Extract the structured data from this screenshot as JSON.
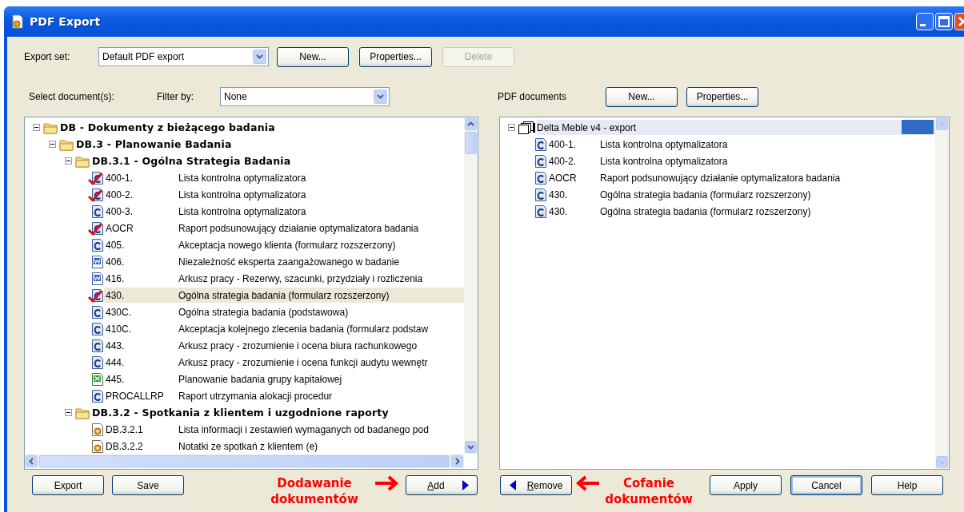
{
  "window": {
    "title": "PDF Export"
  },
  "export_set": {
    "label": "Export set:",
    "value": "Default PDF export",
    "buttons": [
      {
        "label": "New...",
        "disabled": false
      },
      {
        "label": "Properties...",
        "disabled": false
      },
      {
        "label": "Delete",
        "disabled": true
      }
    ]
  },
  "select_label": "Select document(s):",
  "filter": {
    "label": "Filter by:",
    "value": "None"
  },
  "pdf_header": {
    "label": "PDF documents",
    "buttons": [
      {
        "label": "New...",
        "disabled": false
      },
      {
        "label": "Properties...",
        "disabled": false
      }
    ]
  },
  "left_tree": {
    "items": [
      {
        "kind": "folder",
        "label": "DB - Dokumenty z bieżącego badania",
        "expanded": true,
        "children": [
          {
            "kind": "folder",
            "label": "DB.3 - Planowanie Badania",
            "expanded": true,
            "children": [
              {
                "kind": "folder",
                "label": "DB.3.1 - Ogólna Strategia Badania",
                "expanded": true,
                "children": [
                  {
                    "kind": "c-doc",
                    "code": "400-1.",
                    "title": "Lista kontrolna optymalizatora",
                    "checked": true,
                    "selected": false
                  },
                  {
                    "kind": "c-doc",
                    "code": "400-2.",
                    "title": "Lista kontrolna optymalizatora",
                    "checked": true,
                    "selected": false
                  },
                  {
                    "kind": "c-doc",
                    "code": "400-3.",
                    "title": "Lista kontrolna optymalizatora",
                    "checked": false,
                    "selected": false
                  },
                  {
                    "kind": "c-doc",
                    "code": "AOCR",
                    "title": "Raport podsunowujący działanie optymalizatora badania",
                    "checked": true,
                    "selected": false
                  },
                  {
                    "kind": "c-doc",
                    "code": "405.",
                    "title": "Akceptacja nowego klienta (formularz rozszerzony)",
                    "checked": false,
                    "selected": false
                  },
                  {
                    "kind": "word-doc",
                    "code": "406.",
                    "title": "Niezależność eksperta zaangażowanego w badanie",
                    "checked": false,
                    "selected": false
                  },
                  {
                    "kind": "word-doc",
                    "code": "416.",
                    "title": "Arkusz pracy - Rezerwy, szacunki, przydziały i rozliczenia",
                    "checked": false,
                    "selected": false
                  },
                  {
                    "kind": "c-doc",
                    "code": "430.",
                    "title": "Ogólna strategia badania (formularz rozszerzony)",
                    "checked": true,
                    "selected": true
                  },
                  {
                    "kind": "c-doc",
                    "code": "430C.",
                    "title": "Ogólna strategia badania (podstawowa)",
                    "checked": false,
                    "selected": false
                  },
                  {
                    "kind": "c-doc",
                    "code": "410C.",
                    "title": "Akceptacja kolejnego zlecenia badania (formularz podstaw",
                    "checked": false,
                    "selected": false
                  },
                  {
                    "kind": "c-doc",
                    "code": "443.",
                    "title": "Arkusz pracy -  zrozumienie i ocena biura rachunkowego",
                    "checked": false,
                    "selected": false
                  },
                  {
                    "kind": "c-doc",
                    "code": "444.",
                    "title": "Arkusz pracy - zrozumienie i ocena funkcji audytu wewnętr",
                    "checked": false,
                    "selected": false
                  },
                  {
                    "kind": "excel-doc",
                    "code": "445.",
                    "title": "Planowanie badania grupy kapitałowej",
                    "checked": false,
                    "selected": false
                  },
                  {
                    "kind": "c-doc",
                    "code": "PROCALLRP",
                    "title": "Raport utrzymania alokacji procedur",
                    "checked": false,
                    "selected": false
                  }
                ]
              },
              {
                "kind": "folder",
                "label": "DB.3.2 - Spotkania z klientem i uzgodnione raporty",
                "expanded": true,
                "children": [
                  {
                    "kind": "gear-doc",
                    "code": "DB.3.2.1",
                    "title": "Lista informacji i zestawień wymaganych od badanego pod",
                    "checked": false,
                    "selected": false
                  },
                  {
                    "kind": "gear-doc",
                    "code": "DB.3.2.2",
                    "title": "Notatki ze spotkań z klientem (e)",
                    "checked": false,
                    "selected": false
                  }
                ]
              }
            ]
          }
        ]
      }
    ]
  },
  "right_tree": {
    "items": [
      {
        "kind": "export",
        "label": "Delta Meble v4 - export",
        "expanded": true,
        "selected": true,
        "children": [
          {
            "kind": "c-doc",
            "code": "400-1.",
            "title": "Lista kontrolna optymalizatora",
            "checked": false,
            "selected": false
          },
          {
            "kind": "c-doc",
            "code": "400-2.",
            "title": "Lista kontrolna optymalizatora",
            "checked": false,
            "selected": false
          },
          {
            "kind": "c-doc",
            "code": "AOCR",
            "title": "Raport podsunowujący działanie optymalizatora badania",
            "checked": false,
            "selected": false
          },
          {
            "kind": "c-doc",
            "code": "430.",
            "title": "Ogólna strategia badania (formularz rozszerzony)",
            "checked": false,
            "selected": false
          },
          {
            "kind": "c-doc",
            "code": "430.",
            "title": "Ogólna strategia badania (formularz rozszerzony)",
            "checked": false,
            "selected": false
          }
        ]
      }
    ]
  },
  "left_buttons": [
    {
      "label": "Export"
    },
    {
      "label": "Save"
    }
  ],
  "add_note": "Dodawanie dokumentów",
  "add_button": {
    "label": "Add",
    "mnemonic": true
  },
  "remove_button": {
    "label": "Remove",
    "mnemonic": true
  },
  "remove_note": "Cofanie dokumentów",
  "right_buttons": [
    {
      "label": "Apply",
      "focused": false
    },
    {
      "label": "Cancel",
      "focused": true
    },
    {
      "label": "Help",
      "focused": false
    }
  ]
}
